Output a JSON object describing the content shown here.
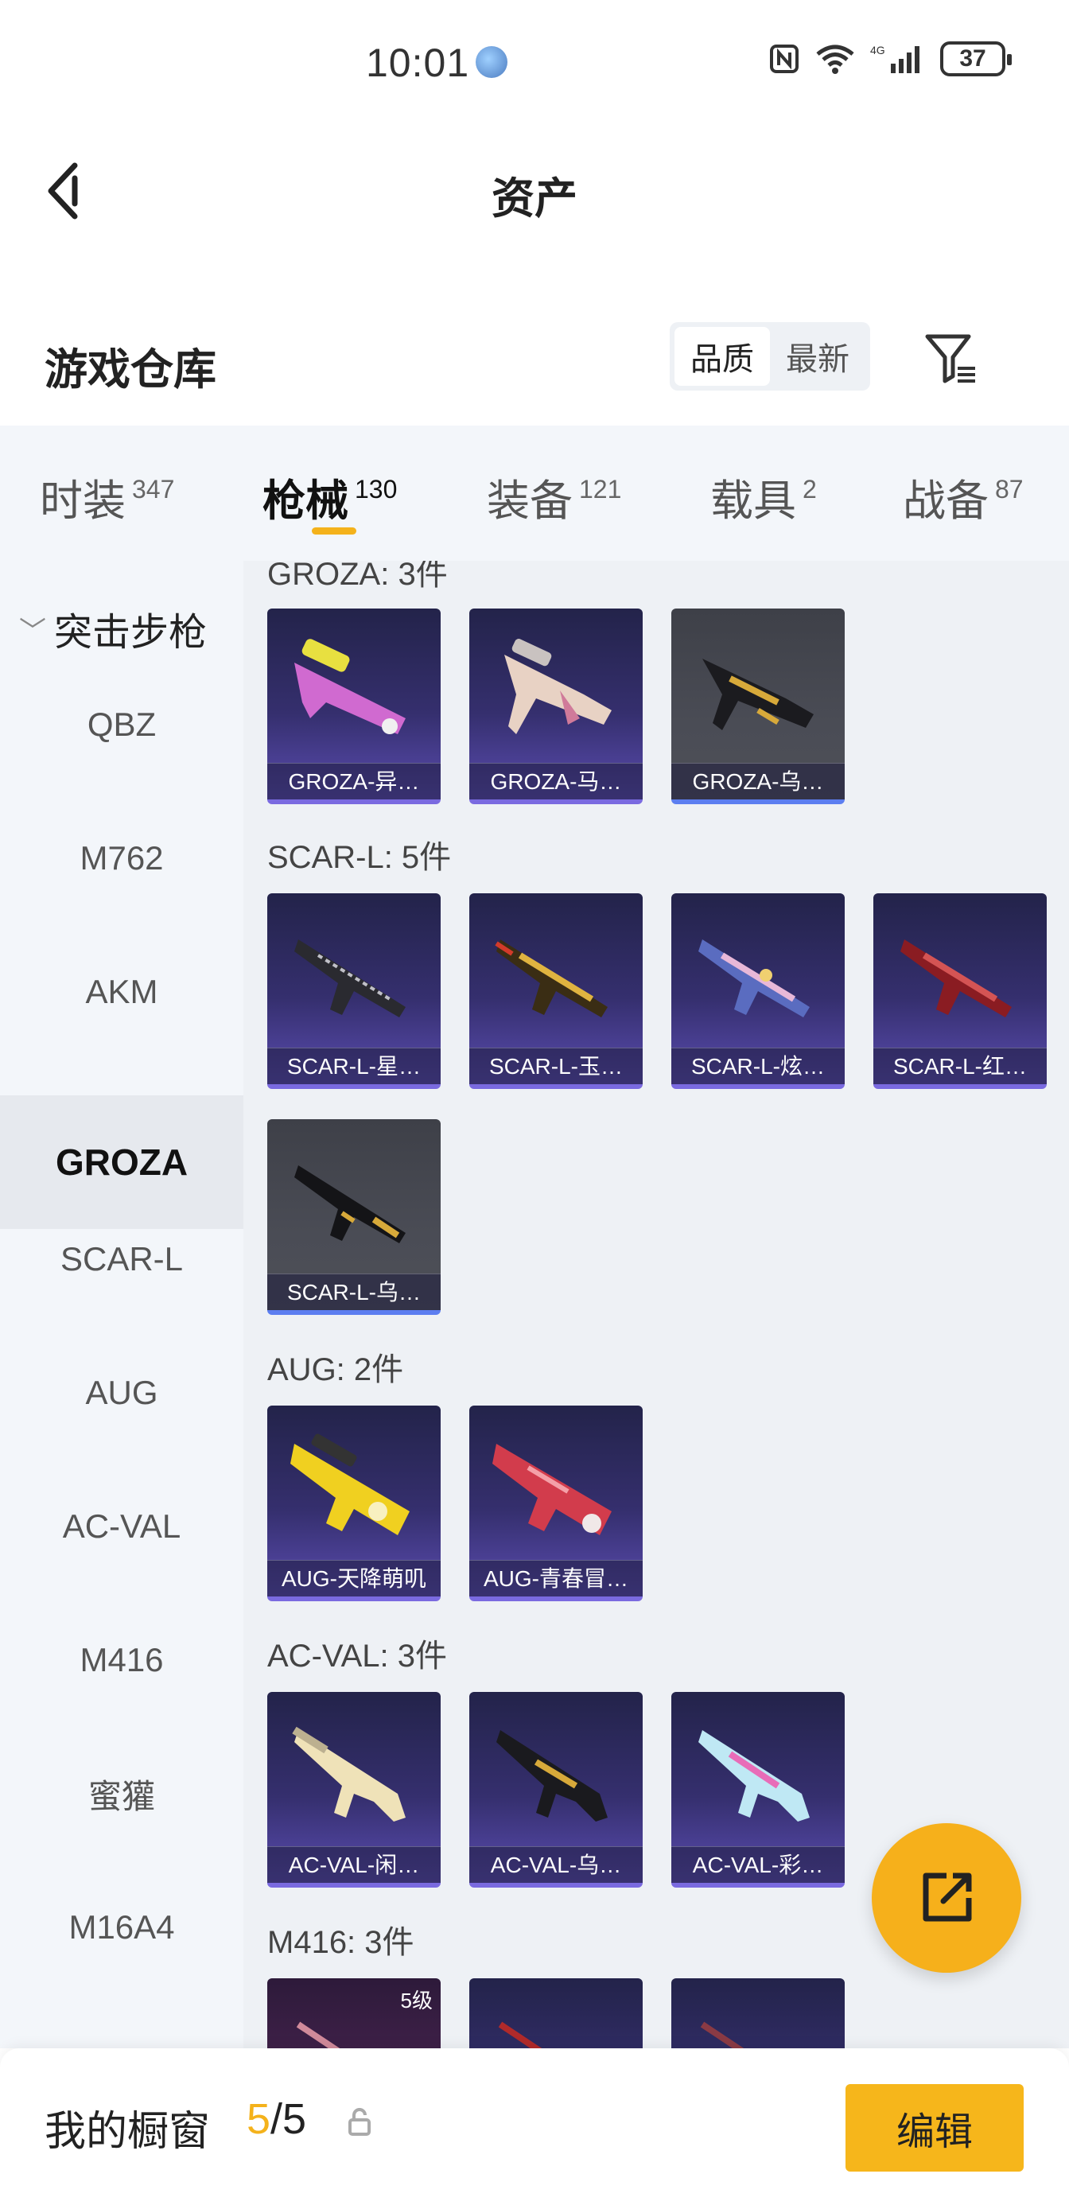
{
  "status_bar": {
    "time": "10:01",
    "battery": "37"
  },
  "header": {
    "title": "资产"
  },
  "warehouse": {
    "title": "游戏仓库",
    "sort_options": [
      "品质",
      "最新"
    ],
    "active_sort": "品质"
  },
  "tabs": [
    {
      "label": "时装",
      "count": "347"
    },
    {
      "label": "枪械",
      "count": "130"
    },
    {
      "label": "装备",
      "count": "121"
    },
    {
      "label": "载具",
      "count": "2"
    },
    {
      "label": "战备",
      "count": "87"
    }
  ],
  "active_tab": "枪械",
  "sidebar": {
    "category": "突击步枪",
    "items": [
      "QBZ",
      "M762",
      "AKM",
      "GROZA",
      "SCAR-L",
      "AUG",
      "AC-VAL",
      "M416",
      "蜜獾",
      "M16A4"
    ],
    "active": "GROZA"
  },
  "groups": [
    {
      "title": "GROZA: 3件",
      "items": [
        "GROZA-异…",
        "GROZA-马…",
        "GROZA-乌…"
      ]
    },
    {
      "title": "SCAR-L: 5件",
      "items": [
        "SCAR-L-星…",
        "SCAR-L-玉…",
        "SCAR-L-炫…",
        "SCAR-L-红…",
        "SCAR-L-乌…"
      ]
    },
    {
      "title": "AUG: 2件",
      "items": [
        "AUG-天降萌叽",
        "AUG-青春冒…"
      ]
    },
    {
      "title": "AC-VAL: 3件",
      "items": [
        "AC-VAL-闲…",
        "AC-VAL-乌…",
        "AC-VAL-彩…"
      ]
    },
    {
      "title": "M416: 3件",
      "items": [
        "5级"
      ]
    }
  ],
  "colors": {
    "accent": "#f4b21b",
    "card_purple": "#352f6e"
  },
  "bottom_bar": {
    "label": "我的橱窗",
    "current": "5",
    "total": "/5",
    "edit_label": "编辑"
  }
}
